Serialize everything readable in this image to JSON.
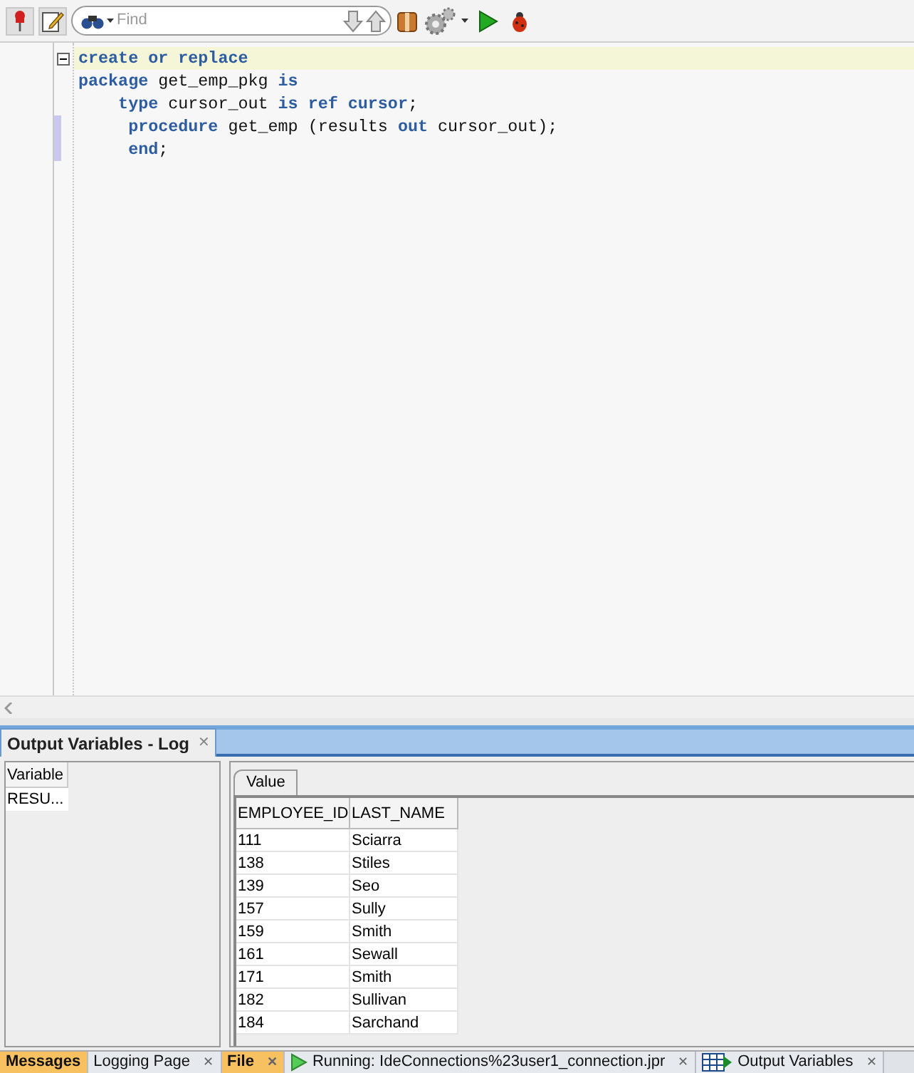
{
  "toolbar": {
    "search": {
      "placeholder": "Find"
    }
  },
  "editor": {
    "lines": [
      {
        "current": true,
        "fold": true,
        "marked": false,
        "tokens": [
          {
            "kind": "keyword",
            "text": "create or replace"
          }
        ]
      },
      {
        "current": false,
        "fold": false,
        "marked": false,
        "tokens": [
          {
            "kind": "keyword",
            "text": "package"
          },
          {
            "kind": "plain",
            "text": " get_emp_pkg "
          },
          {
            "kind": "keyword",
            "text": "is"
          }
        ]
      },
      {
        "current": false,
        "fold": false,
        "marked": false,
        "tokens": [
          {
            "kind": "keyword",
            "text": "    type"
          },
          {
            "kind": "plain",
            "text": " cursor_out "
          },
          {
            "kind": "keyword",
            "text": "is ref cursor"
          },
          {
            "kind": "plain",
            "text": ";"
          }
        ]
      },
      {
        "current": false,
        "fold": false,
        "marked": true,
        "tokens": [
          {
            "kind": "keyword",
            "text": "     procedure"
          },
          {
            "kind": "plain",
            "text": " get_emp (results "
          },
          {
            "kind": "keyword",
            "text": "out"
          },
          {
            "kind": "plain",
            "text": " cursor_out);"
          }
        ]
      },
      {
        "current": false,
        "fold": false,
        "marked": true,
        "tokens": [
          {
            "kind": "keyword",
            "text": "     end"
          },
          {
            "kind": "plain",
            "text": ";"
          }
        ]
      }
    ]
  },
  "output_panel": {
    "title": "Output Variables - Log",
    "close": "✕",
    "variables": {
      "column": "Variable",
      "rows": [
        "RESU..."
      ]
    },
    "value_tab": "Value",
    "table": {
      "columns": [
        "EMPLOYEE_ID",
        "LAST_NAME"
      ],
      "rows": [
        [
          "111",
          "Sciarra"
        ],
        [
          "138",
          "Stiles"
        ],
        [
          "139",
          "Seo"
        ],
        [
          "157",
          "Sully"
        ],
        [
          "159",
          "Smith"
        ],
        [
          "161",
          "Sewall"
        ],
        [
          "171",
          "Smith"
        ],
        [
          "182",
          "Sullivan"
        ],
        [
          "184",
          "Sarchand"
        ]
      ]
    }
  },
  "bottom_tabs": [
    {
      "kind": "plain",
      "label": "Messages",
      "highlighted": true
    },
    {
      "kind": "plain",
      "label": "Logging Page",
      "highlighted": false,
      "close": "✕"
    },
    {
      "kind": "plain",
      "label": "File",
      "highlighted": true,
      "close": "✕"
    },
    {
      "kind": "run",
      "label": "Running: IdeConnections%23user1_connection.jpr",
      "highlighted": false,
      "close": "✕"
    },
    {
      "kind": "table",
      "label": "Output Variables",
      "highlighted": false,
      "close": "✕"
    }
  ]
}
